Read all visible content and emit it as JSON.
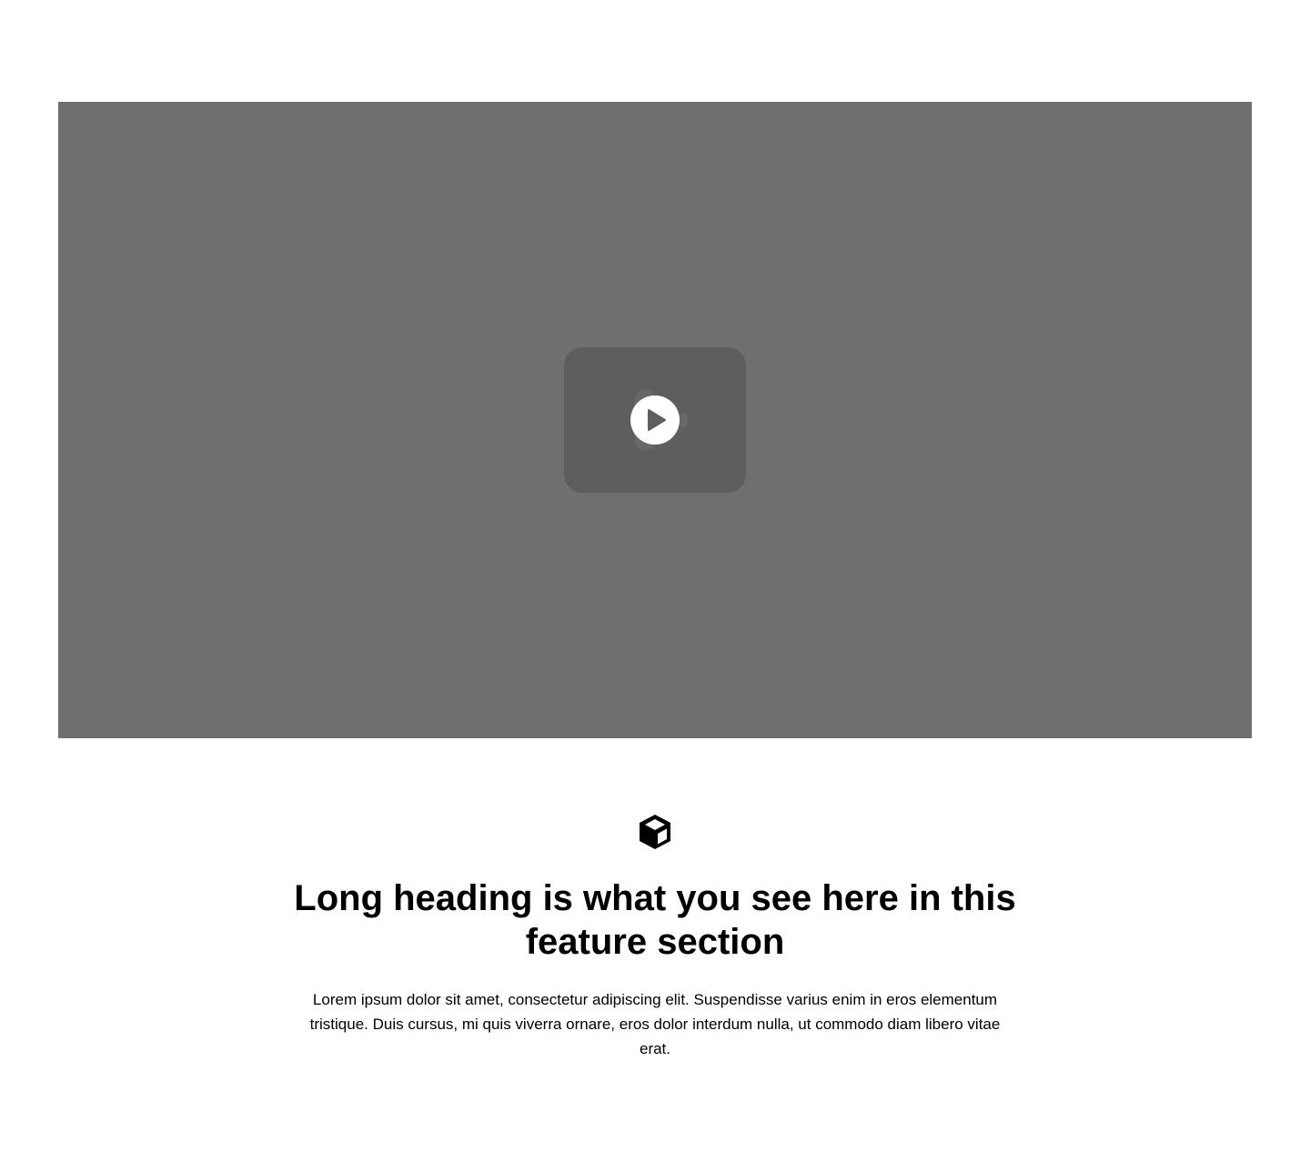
{
  "video": {
    "play_icon": "play-icon",
    "colors": {
      "background": "#6f6f6f",
      "placeholder": "#5e5e5e",
      "play_button": "#ffffff"
    }
  },
  "feature": {
    "icon": "cube-icon",
    "heading": "Long heading is what you see here in this feature section",
    "body": "Lorem ipsum dolor sit amet, consectetur adipiscing elit. Suspendisse varius enim in eros elementum tristique. Duis cursus, mi quis viverra ornare, eros dolor interdum nulla, ut commodo diam libero vitae erat."
  }
}
